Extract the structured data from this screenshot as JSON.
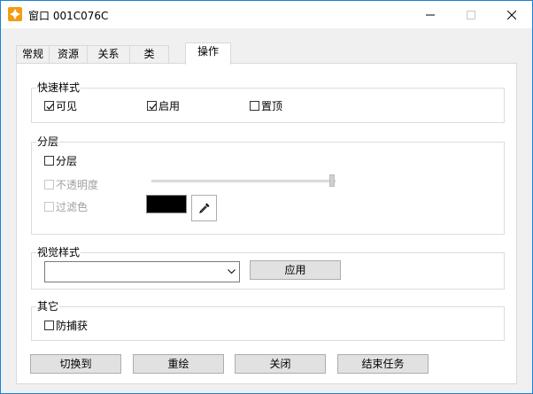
{
  "window": {
    "title": "窗口 001C076C",
    "accent": "#1883d7",
    "icon": "app-icon"
  },
  "tabs": [
    {
      "label": "常规"
    },
    {
      "label": "资源"
    },
    {
      "label": "关系"
    },
    {
      "label": "类"
    },
    {
      "label": "操作",
      "active": true
    }
  ],
  "quick_style": {
    "title": "快速样式",
    "visible": {
      "label": "可见",
      "checked": true
    },
    "enabled": {
      "label": "启用",
      "checked": true
    },
    "topmost": {
      "label": "置顶",
      "checked": false
    }
  },
  "layering": {
    "title": "分层",
    "layered": {
      "label": "分层",
      "checked": false
    },
    "opacity": {
      "label": "不透明度",
      "checked": false,
      "disabled": true,
      "slider_level": 1.0
    },
    "filter_color": {
      "label": "过滤色",
      "checked": false,
      "disabled": true,
      "color": "#000000",
      "picker_icon": "eyedropper-icon"
    }
  },
  "visual_style": {
    "title": "视觉样式",
    "value": "",
    "apply_label": "应用"
  },
  "other": {
    "title": "其它",
    "anti_capture": {
      "label": "防捕获",
      "checked": false
    }
  },
  "buttons": {
    "switch_to": "切换到",
    "redraw": "重绘",
    "close": "关闭",
    "end_task": "结束任务"
  }
}
